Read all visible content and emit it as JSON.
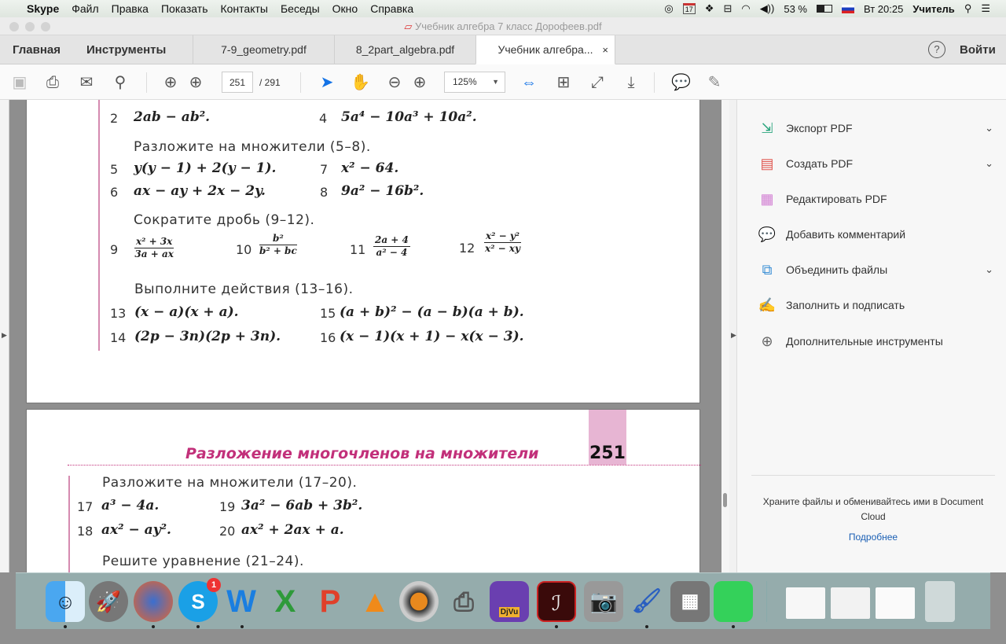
{
  "menubar": {
    "app": "Skype",
    "items": [
      "Файл",
      "Правка",
      "Показать",
      "Контакты",
      "Беседы",
      "Окно",
      "Справка"
    ],
    "calendar_day": "17",
    "battery": "53 %",
    "clock": "Вт 20:25",
    "user": "Учитель"
  },
  "window": {
    "title": "Учебник алгебра 7 класс Дорофеев.pdf"
  },
  "tabs": {
    "home": "Главная",
    "tools": "Инструменты",
    "docs": [
      "7-9_geometry.pdf",
      "8_2part_algebra.pdf",
      "Учебник алгебра..."
    ],
    "close": "×",
    "help": "?",
    "signin": "Войти"
  },
  "toolbar": {
    "page_current": "251",
    "page_total": "/ 291",
    "zoom": "125%"
  },
  "page1": {
    "row_a": [
      {
        "n": "2",
        "e": "2ab − ab²."
      },
      {
        "n": "4",
        "e": "5a⁴ − 10a³ + 10a²."
      }
    ],
    "h1": "Разложите на множители (5–8).",
    "row_b": [
      {
        "n": "5",
        "e": "y(y − 1) + 2(y − 1)."
      },
      {
        "n": "7",
        "e": "x² − 64."
      }
    ],
    "row_c": [
      {
        "n": "6",
        "e": "ax − ay + 2x − 2y."
      },
      {
        "n": "8",
        "e": "9a² − 16b²."
      }
    ],
    "h2": "Сократите дробь (9–12).",
    "fracs": [
      {
        "n": "9",
        "num": "x² + 3x",
        "den": "3a + ax"
      },
      {
        "n": "10",
        "num": "b²",
        "den": "b² + bc"
      },
      {
        "n": "11",
        "num": "2a + 4",
        "den": "a² − 4"
      },
      {
        "n": "12",
        "num": "x² − y²",
        "den": "x² − xy"
      }
    ],
    "h3": "Выполните действия (13–16).",
    "row_d": [
      {
        "n": "13",
        "e": "(x − a)(x + a)."
      },
      {
        "n": "15",
        "e": "(a + b)² − (a − b)(a + b)."
      }
    ],
    "row_e": [
      {
        "n": "14",
        "e": "(2p − 3n)(2p + 3n)."
      },
      {
        "n": "16",
        "e": "(x − 1)(x + 1) − x(x − 3)."
      }
    ]
  },
  "page2": {
    "chapter": "Разложение многочленов на множители",
    "page_no": "251",
    "h1": "Разложите на множители (17–20).",
    "row_a": [
      {
        "n": "17",
        "e": "a³ − 4a."
      },
      {
        "n": "19",
        "e": "3a² − 6ab + 3b²."
      }
    ],
    "row_b": [
      {
        "n": "18",
        "e": "ax² − ay²."
      },
      {
        "n": "20",
        "e": "ax² + 2ax + a."
      }
    ],
    "h2": "Решите уравнение (21–24)."
  },
  "rightpanel": {
    "items": [
      "Экспорт PDF",
      "Создать PDF",
      "Редактировать PDF",
      "Добавить комментарий",
      "Объединить файлы",
      "Заполнить и подписать",
      "Дополнительные инструменты"
    ],
    "promo": "Храните файлы и обменивайтесь ими в Document Cloud",
    "more": "Подробнее"
  },
  "dock": {
    "skype_badge": "1",
    "djvu_label": "DjVu"
  },
  "colors": {
    "accent": "#1473e6",
    "chapter": "#c2307a"
  }
}
